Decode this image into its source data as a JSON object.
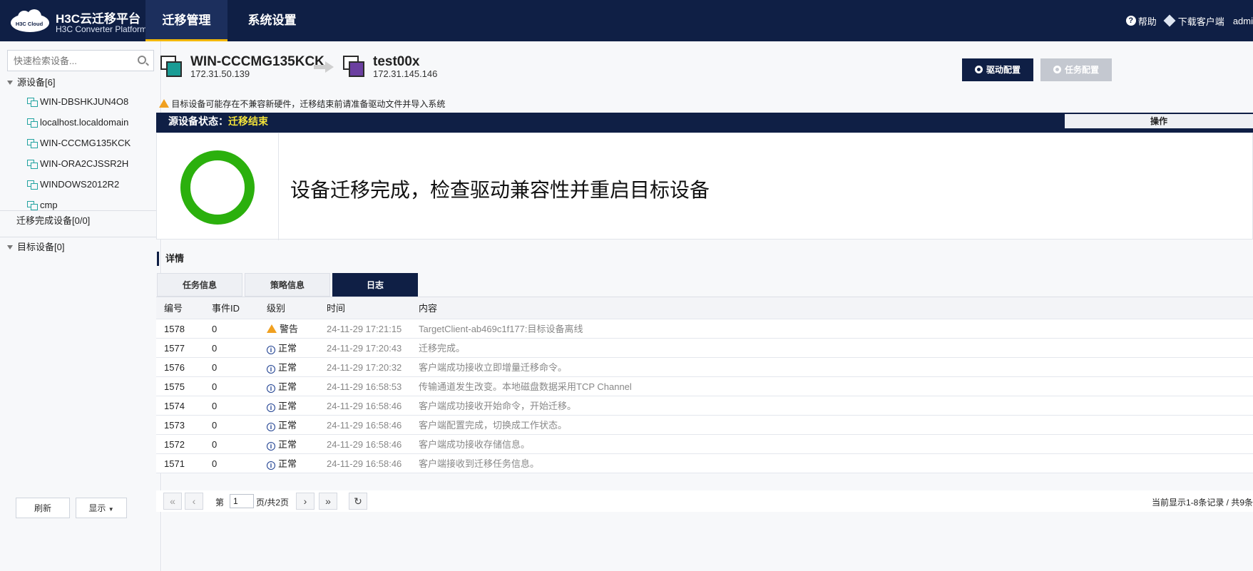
{
  "app": {
    "title": "H3C云迁移平台",
    "subtitle": "H3C Converter Platform",
    "logo_text": "H3C Cloud"
  },
  "nav": {
    "tabs": [
      {
        "label": "迁移管理",
        "active": true
      },
      {
        "label": "系统设置",
        "active": false
      }
    ]
  },
  "topbar": {
    "help": "帮助",
    "download": "下载客户端",
    "user": "admi"
  },
  "sidebar": {
    "search_placeholder": "快速检索设备...",
    "source_group": "源设备[6]",
    "source_items": [
      "WIN-DBSHKJUN4O8",
      "localhost.localdomain",
      "WIN-CCCMG135KCK",
      "WIN-ORA2CJSSR2H",
      "WINDOWS2012R2",
      "cmp"
    ],
    "done_group": "迁移完成设备[0/0]",
    "target_group": "目标设备[0]",
    "refresh": "刷新",
    "display": "显示"
  },
  "migration": {
    "source_name": "WIN-CCCMG135KCK",
    "source_ip": "172.31.50.139",
    "target_name": "test00x",
    "target_ip": "172.31.145.146",
    "driver_config": "驱动配置",
    "task_config": "任务配置",
    "warning": "目标设备可能存在不兼容新硬件，迁移结束前请准备驱动文件并导入系统"
  },
  "status": {
    "label": "源设备状态：",
    "value": "迁移结束",
    "op_header": "操作",
    "message": "设备迁移完成，检查驱动兼容性并重启目标设备"
  },
  "details": {
    "title": "详情",
    "tabs": [
      {
        "label": "任务信息",
        "active": false
      },
      {
        "label": "策略信息",
        "active": false
      },
      {
        "label": "日志",
        "active": true
      }
    ],
    "columns": [
      "编号",
      "事件ID",
      "级别",
      "时间",
      "内容"
    ],
    "rows": [
      {
        "id": "1578",
        "event": "0",
        "level": "警告",
        "level_type": "warn",
        "time": "24-11-29 17:21:15",
        "content": "TargetClient-ab469c1f177:目标设备离线"
      },
      {
        "id": "1577",
        "event": "0",
        "level": "正常",
        "level_type": "info",
        "time": "24-11-29 17:20:43",
        "content": "迁移完成。"
      },
      {
        "id": "1576",
        "event": "0",
        "level": "正常",
        "level_type": "info",
        "time": "24-11-29 17:20:32",
        "content": "客户端成功接收立即增量迁移命令。"
      },
      {
        "id": "1575",
        "event": "0",
        "level": "正常",
        "level_type": "info",
        "time": "24-11-29 16:58:53",
        "content": "传输通道发生改变。本地磁盘数据采用TCP Channel"
      },
      {
        "id": "1574",
        "event": "0",
        "level": "正常",
        "level_type": "info",
        "time": "24-11-29 16:58:46",
        "content": "客户端成功接收开始命令，开始迁移。"
      },
      {
        "id": "1573",
        "event": "0",
        "level": "正常",
        "level_type": "info",
        "time": "24-11-29 16:58:46",
        "content": "客户端配置完成，切换成工作状态。"
      },
      {
        "id": "1572",
        "event": "0",
        "level": "正常",
        "level_type": "info",
        "time": "24-11-29 16:58:46",
        "content": "客户端成功接收存储信息。"
      },
      {
        "id": "1571",
        "event": "0",
        "level": "正常",
        "level_type": "info",
        "time": "24-11-29 16:58:46",
        "content": "客户端接收到迁移任务信息。"
      }
    ]
  },
  "pager": {
    "page_label": "第",
    "page_value": "1",
    "page_total": "页/共2页",
    "summary": "当前显示1-8条记录 / 共9条"
  },
  "colors": {
    "nav_bg": "#0f1f45",
    "accent": "#f2b705",
    "ring": "#2bb00d",
    "status_value": "#f3e33a"
  }
}
